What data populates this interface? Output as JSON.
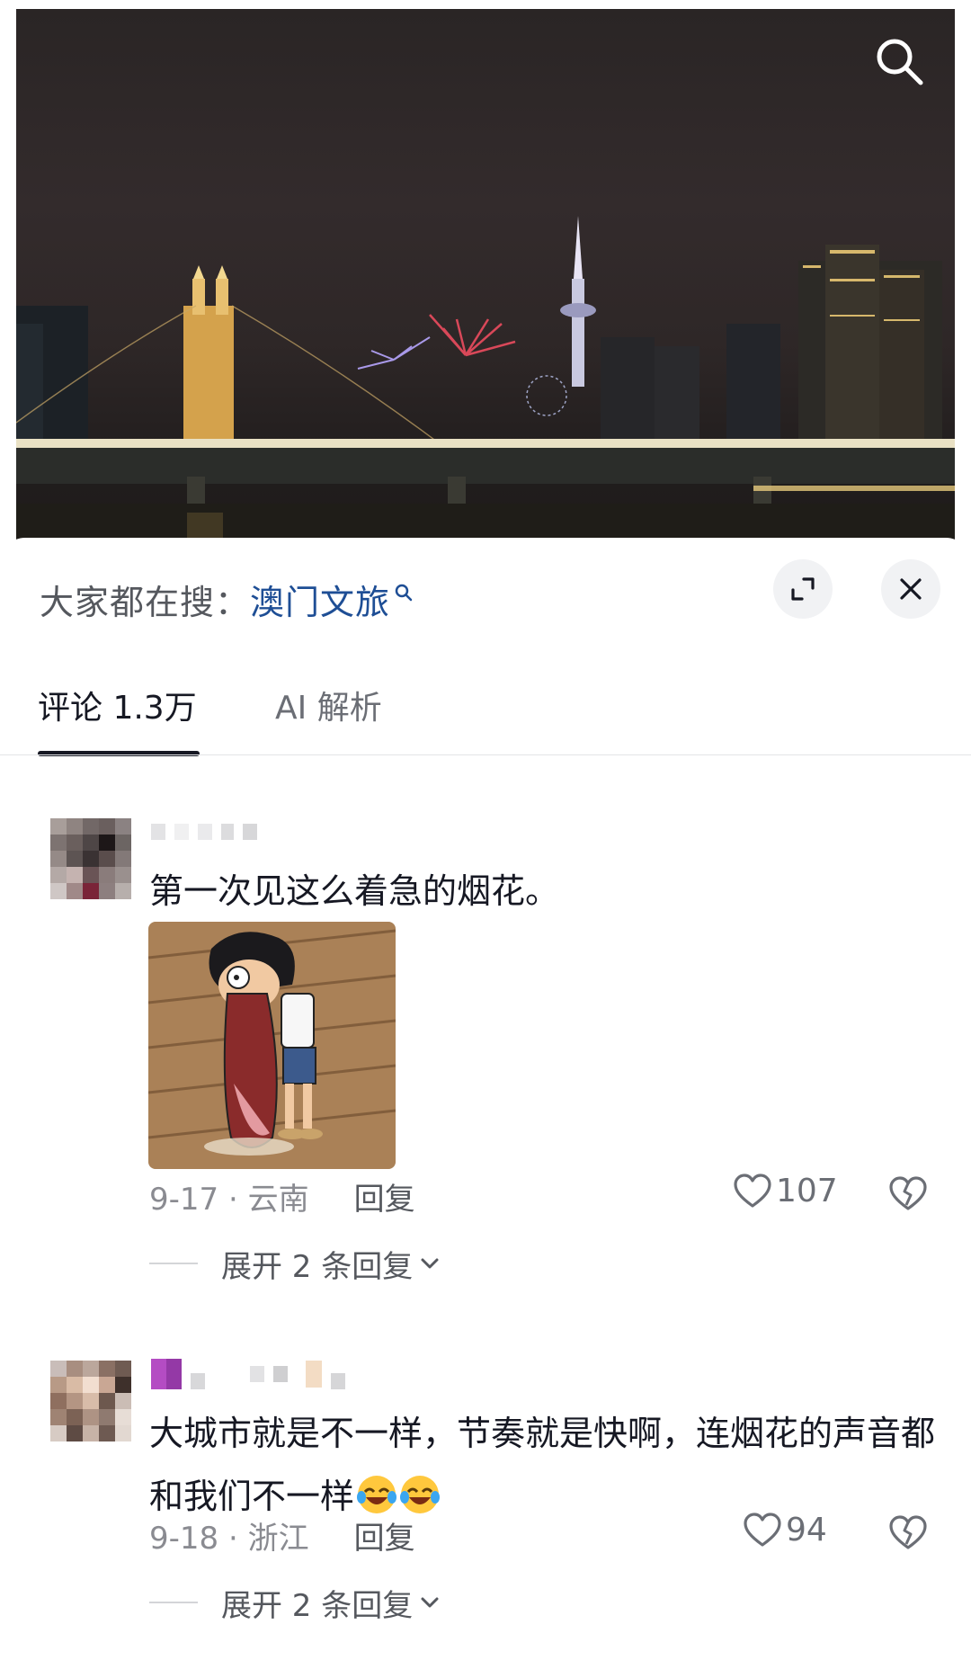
{
  "header": {
    "hot_search_label": "大家都在搜：",
    "hot_search_term": "澳门文旅"
  },
  "tabs": [
    {
      "label": "评论 1.3万",
      "active": true
    },
    {
      "label": "AI 解析",
      "active": false
    }
  ],
  "comments": [
    {
      "text": "第一次见这么着急的烟花。",
      "date_location": "9-17 · 云南",
      "reply_label": "回复",
      "likes": "107",
      "expand_label": "展开 2 条回复",
      "has_sticker": true
    },
    {
      "text": "大城市就是不一样，节奏就是快啊，连烟花的声音都和我们不一样",
      "date_location": "9-18 · 浙江",
      "reply_label": "回复",
      "likes": "94",
      "expand_label": "展开 2 条回复",
      "emoji": "grinning-squinting-face-with-tears x2"
    }
  ],
  "colors": {
    "text_primary": "#161823",
    "text_secondary": "#8a8b91",
    "link_blue": "#1e4e95",
    "button_bg": "#f1f2f4"
  },
  "icons": [
    "search-icon",
    "search-small-icon",
    "expand-icon",
    "close-icon",
    "heart-icon",
    "broken-heart-icon",
    "chevron-down-icon"
  ]
}
